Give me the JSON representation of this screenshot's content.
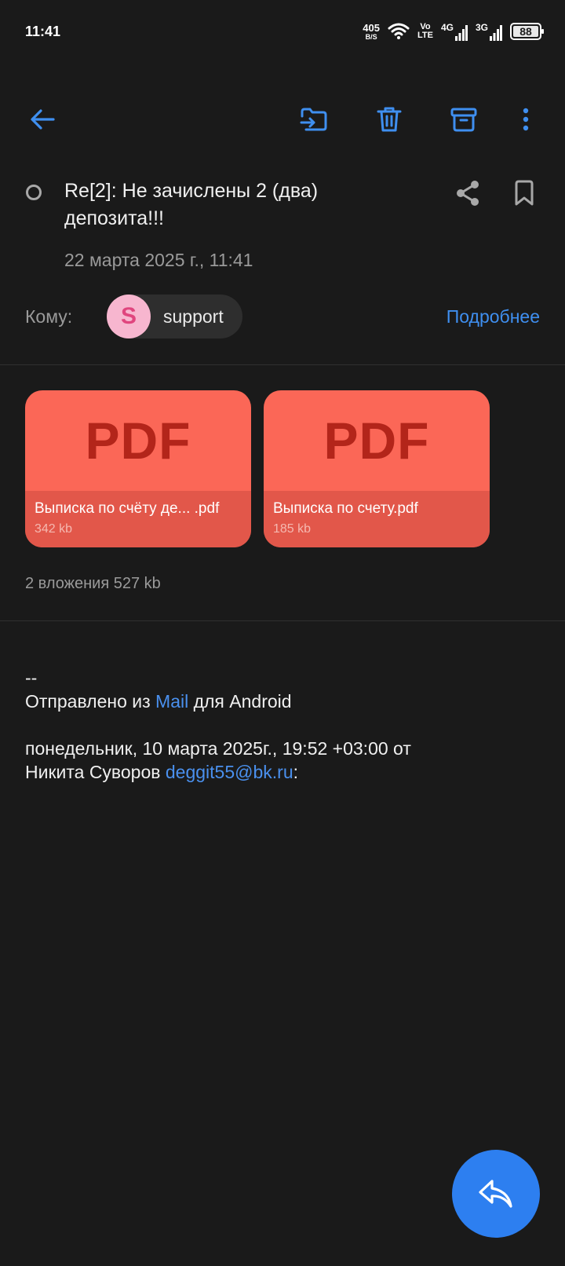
{
  "status_bar": {
    "time": "11:41",
    "net_speed": "405",
    "net_speed_unit": "B/S",
    "volte_top": "Vo",
    "volte_bottom": "LTE",
    "net1": "4G",
    "net2": "3G",
    "battery": "88"
  },
  "toolbar": {
    "back": "back-arrow-icon",
    "move": "move-to-folder-icon",
    "delete": "trash-icon",
    "archive": "archive-icon",
    "more": "more-vert-icon"
  },
  "message": {
    "subject": "Re[2]: Не зачислены 2 (два) депозита!!!",
    "date": "22 марта 2025 г., 11:41",
    "to_label": "Кому:",
    "recipient_initial": "S",
    "recipient_name": "support",
    "details_link": "Подробнее"
  },
  "attachments": {
    "items": [
      {
        "badge": "PDF",
        "name": "Выписка по счёту де... .pdf",
        "size": "342  kb"
      },
      {
        "badge": "PDF",
        "name": "Выписка по счету.pdf",
        "size": "185  kb"
      }
    ],
    "total": "2 вложения 527  kb"
  },
  "body": {
    "separator": "--",
    "sent_from_prefix": "Отправлено из ",
    "sent_from_link": "Mail",
    "sent_from_suffix": " для Android",
    "quote_line1": "понедельник, 10 марта 2025г., 19:52 +03:00 от",
    "quote_author": "Никита Суворов ",
    "quote_email": "deggit55@bk.ru",
    "quote_colon": ":"
  },
  "colors": {
    "background": "#1a1a1a",
    "accent": "#2d7ff0",
    "pdf_card": "#fb6757"
  }
}
